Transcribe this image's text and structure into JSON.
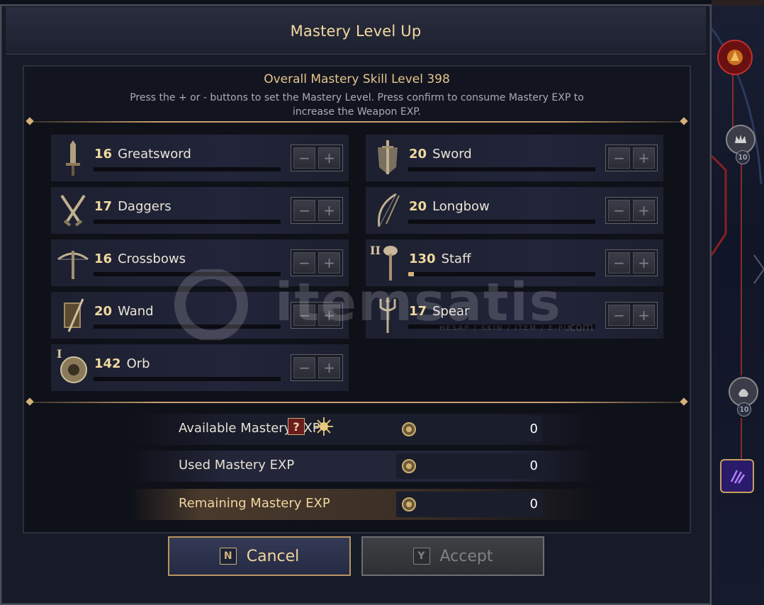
{
  "dialog": {
    "title": "Mastery Level Up",
    "overall": "Overall Mastery Skill Level 398",
    "instructions": "Press the + or - buttons to set the Mastery Level. Press confirm to consume Mastery EXP to increase the Weapon EXP."
  },
  "weapons": [
    {
      "level": "16",
      "name": "Greatsword",
      "icon": "greatsword-icon",
      "progress": 0
    },
    {
      "level": "20",
      "name": "Sword",
      "icon": "sword-shield-icon",
      "progress": 0
    },
    {
      "level": "17",
      "name": "Daggers",
      "icon": "daggers-icon",
      "progress": 0
    },
    {
      "level": "20",
      "name": "Longbow",
      "icon": "longbow-icon",
      "progress": 0
    },
    {
      "level": "16",
      "name": "Crossbows",
      "icon": "crossbow-icon",
      "progress": 0
    },
    {
      "level": "130",
      "name": "Staff",
      "icon": "staff-icon",
      "badge": "II",
      "progress": 0.03
    },
    {
      "level": "20",
      "name": "Wand",
      "icon": "wand-icon",
      "progress": 0
    },
    {
      "level": "17",
      "name": "Spear",
      "icon": "spear-icon",
      "progress": 0
    },
    {
      "level": "142",
      "name": "Orb",
      "icon": "orb-icon",
      "badge": "I",
      "progress": 0
    }
  ],
  "stepper": {
    "minus": "−",
    "plus": "+"
  },
  "exp": {
    "available_label": "Available Mastery EXP",
    "available_value": "0",
    "help": "?",
    "used_label": "Used Mastery EXP",
    "used_value": "0",
    "remaining_label": "Remaining Mastery EXP",
    "remaining_value": "0"
  },
  "buttons": {
    "cancel_key": "N",
    "cancel_label": "Cancel",
    "accept_key": "Y",
    "accept_label": "Accept"
  },
  "side": {
    "badge1": "10",
    "badge2": "10"
  },
  "watermark": {
    "brand": "itemsatis",
    "tagline": "HESAP / SKIN / ITEM / E-PIN",
    "suffix": ".com"
  },
  "colors": {
    "gold": "#f1d9a0",
    "accent": "#c9a070",
    "panel": "#0f1119"
  }
}
